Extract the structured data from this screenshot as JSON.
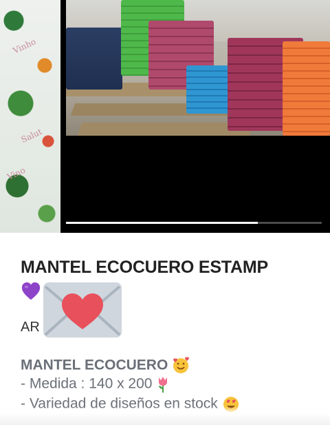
{
  "gallery": {
    "left_photo": "tablecloth-print-photo",
    "main_photo": "stacked-tablecloths-photo",
    "progress": 0.75,
    "left_photo_text": [
      "Vinho",
      "Salut",
      "Vino"
    ]
  },
  "post": {
    "title": "MANTEL ECOCUERO ESTAMP",
    "title_emoji": "purple-heart-icon",
    "sticker": "love-letter-envelope-icon",
    "country_prefix": "AR",
    "section_title": "MANTEL ECOCUERO",
    "section_title_emoji": "smiling-face-with-hearts-icon",
    "bullets": [
      {
        "text": "- Medida : 140 x 200",
        "emoji": "tulip-icon"
      },
      {
        "text": "- Variedad de diseños en stock",
        "emoji": "heart-eyes-icon"
      }
    ]
  },
  "colors": {
    "title": "#222222",
    "body_gray": "#6b7078",
    "heart_red": "#e8505b",
    "envelope": "#cfd6dd",
    "purple": "#8e44c9"
  }
}
